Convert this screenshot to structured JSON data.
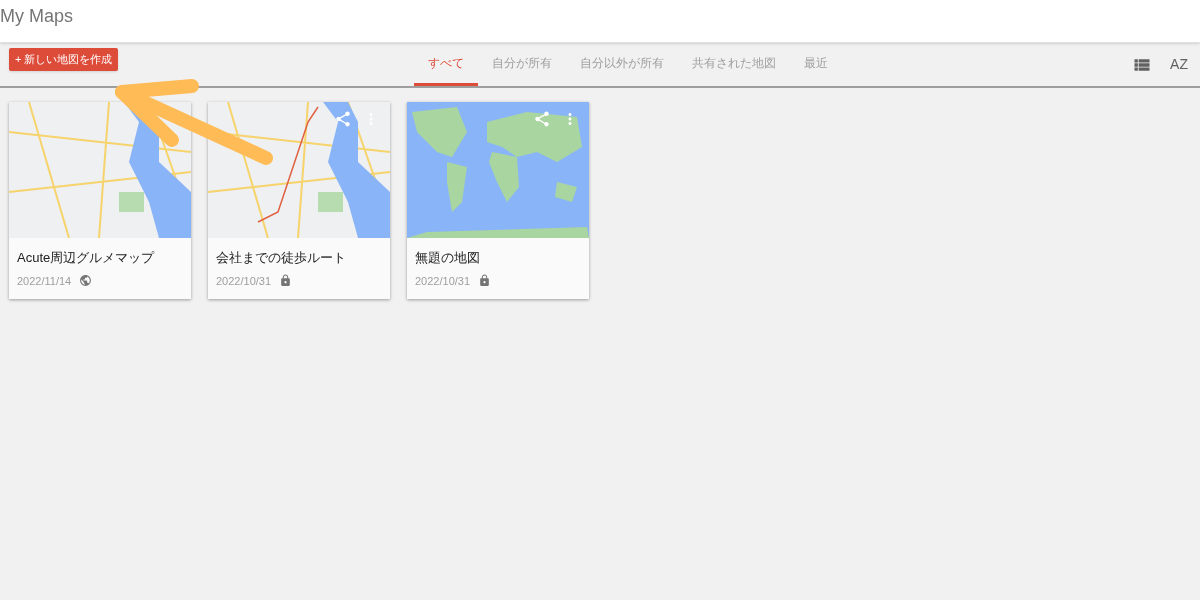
{
  "app_title": "My Maps",
  "new_map_button": "+ 新しい地図を作成",
  "tabs": [
    {
      "label": "すべて",
      "selected": true
    },
    {
      "label": "自分が所有",
      "selected": false
    },
    {
      "label": "自分以外が所有",
      "selected": false
    },
    {
      "label": "共有された地図",
      "selected": false
    },
    {
      "label": "最近",
      "selected": false
    }
  ],
  "sort_button": "AZ",
  "maps": [
    {
      "title": "Acute周辺グルメマップ",
      "date": "2022/11/14",
      "public": true,
      "kind": "city",
      "show_actions": false
    },
    {
      "title": "会社までの徒歩ルート",
      "date": "2022/10/31",
      "public": false,
      "kind": "route",
      "show_actions": true
    },
    {
      "title": "無題の地図",
      "date": "2022/10/31",
      "public": false,
      "kind": "world",
      "show_actions": true
    }
  ]
}
